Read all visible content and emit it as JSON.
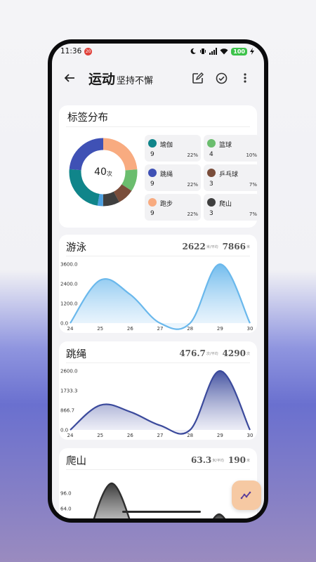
{
  "status_bar": {
    "time": "11:36",
    "notification_badge": "20",
    "battery": "100",
    "icons": [
      "moon-icon",
      "vibrate-icon",
      "signal-icon",
      "wifi-icon",
      "battery-icon",
      "charging-icon"
    ]
  },
  "app_bar": {
    "title": "运动",
    "subtitle": "坚持不懈",
    "icons": [
      "back-arrow-icon",
      "edit-icon",
      "check-circle-icon",
      "more-vert-icon"
    ]
  },
  "tag_distribution": {
    "title": "标签分布",
    "total": "40",
    "total_unit": "次",
    "items": [
      {
        "name": "瑜伽",
        "count": "9",
        "pct": "22%",
        "color": "#10858a"
      },
      {
        "name": "篮球",
        "count": "4",
        "pct": "10%",
        "color": "#6bbd6e"
      },
      {
        "name": "跳绳",
        "count": "9",
        "pct": "22%",
        "color": "#3f51b5"
      },
      {
        "name": "乒乓球",
        "count": "3",
        "pct": "7%",
        "color": "#7a4d3a"
      },
      {
        "name": "跑步",
        "count": "9",
        "pct": "22%",
        "color": "#f8ab80"
      },
      {
        "name": "爬山",
        "count": "3",
        "pct": "7%",
        "color": "#3f3f3f"
      }
    ],
    "extra_segment_color": "#4a9fe0"
  },
  "charts": [
    {
      "title": "游泳",
      "avg_value": "2622",
      "avg_unit": "米/平均",
      "total_value": "7866",
      "total_unit": "米",
      "color": "#6ab8ec",
      "fill_top": "#6ab8ec",
      "fill_bottom": "#e7f3fd",
      "chart_data": {
        "type": "area",
        "x": [
          "24",
          "25",
          "26",
          "27",
          "28",
          "29",
          "30"
        ],
        "y_ticks": [
          "0.0",
          "1200.0",
          "2400.0",
          "3600.0"
        ],
        "ylim": [
          0,
          3600
        ],
        "values": [
          0,
          2622,
          1750,
          0,
          0,
          3600,
          0
        ]
      }
    },
    {
      "title": "跳绳",
      "avg_value": "476.7",
      "avg_unit": "次/平均",
      "total_value": "4290",
      "total_unit": "次",
      "color": "#3b4a9c",
      "fill_top": "#3b4a9c",
      "fill_bottom": "#ecedf7",
      "chart_data": {
        "type": "area",
        "x": [
          "24",
          "25",
          "26",
          "27",
          "28",
          "29",
          "30"
        ],
        "y_ticks": [
          "0.0",
          "866.7",
          "1733.3",
          "2600.0"
        ],
        "ylim": [
          0,
          2600
        ],
        "values": [
          0,
          1090,
          800,
          200,
          0,
          2600,
          0
        ]
      }
    },
    {
      "title": "爬山",
      "avg_value": "63.3",
      "avg_unit": "米/平均",
      "total_value": "190",
      "total_unit": "米",
      "color": "#2f2f2f",
      "fill_top": "#2f2f2f",
      "fill_bottom": "#d9d9d9",
      "chart_data": {
        "type": "area",
        "y_ticks": [
          "64.0",
          "96.0"
        ],
        "ylim": [
          0,
          128
        ]
      }
    }
  ],
  "fab_icon": "trend-chart-icon"
}
